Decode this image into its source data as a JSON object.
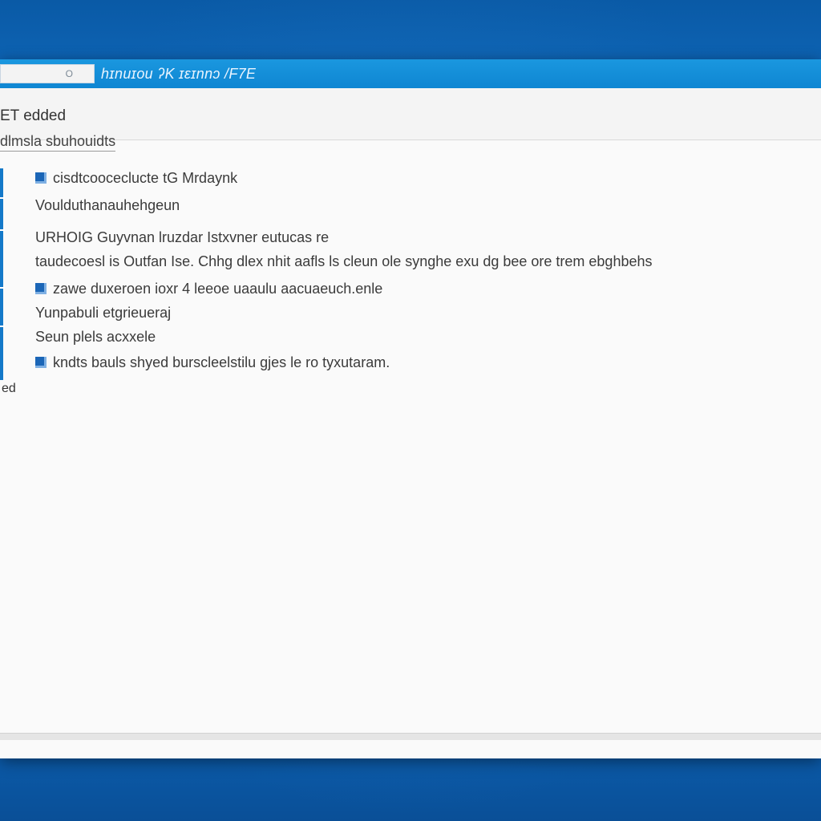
{
  "window": {
    "search_text": "O",
    "title": "hɪnuɪou ʔK ɪɛɪnnɔ /F7E"
  },
  "header": {
    "page_heading": "ET edded",
    "sub_heading": "dlmsla sbuhouidts"
  },
  "rail": {
    "label": "ed"
  },
  "content": {
    "lines": [
      {
        "text": "cisdtcooceclucte tG Mrdaynk",
        "icon": "app-icon"
      },
      {
        "text": "Voulduthanauhehgeun",
        "icon": null
      },
      {
        "text": "URHOIG Guyvnan lruzdar Istxvner eutucas re",
        "icon": null
      },
      {
        "text": "taudecoesl is Outfan Ise. Chhg dlex nhit aafls ls cleun ole synghe exu dg bee ore trem ebghbehs",
        "icon": null
      },
      {
        "text": "zawe duxeroen ioxr 4 leeoe uaaulu aacuaeuch.enle",
        "icon": "checkbox-icon"
      },
      {
        "text": "Yunpabuli etgrieueraj",
        "icon": null
      },
      {
        "text": "Seun plels acxxele",
        "icon": null
      },
      {
        "text": "kndts bauls shyed burscleelstilu gjes le ro tyxutaram.",
        "icon": "checkbox-icon"
      }
    ]
  },
  "colors": {
    "titlebar": "#1a97df",
    "desktop": "#0b4f95",
    "accent": "#1479c9"
  }
}
